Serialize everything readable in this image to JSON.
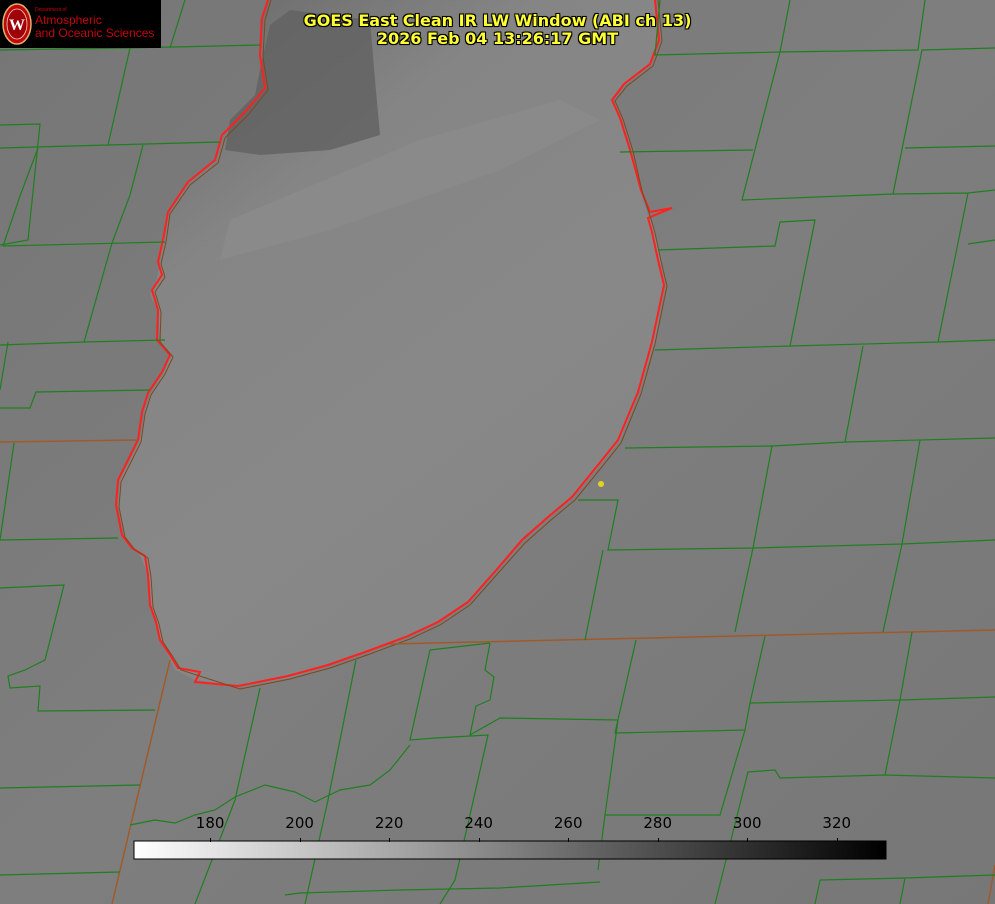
{
  "title": {
    "line1": "GOES East Clean IR LW Window (ABI ch 13)",
    "line2": "2026 Feb 04 13:26:17 GMT"
  },
  "logo": {
    "dept": "Department of",
    "line1": "Atmospheric",
    "line2": "and Oceanic Sciences",
    "seal_letter": "W"
  },
  "colorbar": {
    "ticks": [
      "180",
      "200",
      "220",
      "240",
      "260",
      "280",
      "300",
      "320"
    ],
    "tick_values": [
      180,
      200,
      220,
      240,
      260,
      280,
      300,
      320
    ],
    "range": [
      163,
      331
    ],
    "gradient": [
      "#ffffff",
      "#000000"
    ]
  },
  "colors": {
    "coastline": "#ff2020",
    "county_lines": "#1f7f1f",
    "state_lines": "#a05a2a",
    "title_text": "#ffff33",
    "site_marker": "#e6d21e"
  },
  "map": {
    "feature": "lake",
    "marker": "site-marker"
  }
}
